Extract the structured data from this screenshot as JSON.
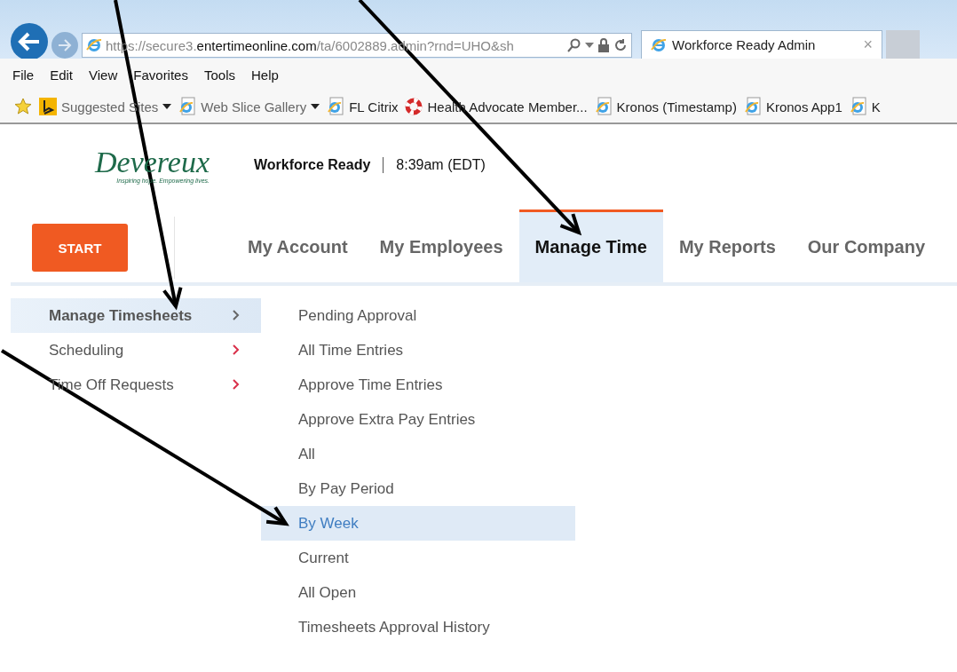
{
  "browser": {
    "url": {
      "prefix": "https://secure3.",
      "domain": "entertimeonline.com",
      "path": "/ta/6002889.admin?rnd=UHO&sh"
    },
    "tab": {
      "title": "Workforce Ready Admin",
      "close": "×"
    },
    "menu": [
      "File",
      "Edit",
      "View",
      "Favorites",
      "Tools",
      "Help"
    ],
    "favorites": [
      {
        "kind": "bing",
        "label": "Suggested Sites",
        "dropdown": true
      },
      {
        "kind": "ie",
        "label": "Web Slice Gallery",
        "dropdown": true
      },
      {
        "kind": "ie",
        "label": "FL Citrix",
        "dropdown": false
      },
      {
        "kind": "lifebuoy",
        "label": "Health Advocate Member...",
        "dropdown": false
      },
      {
        "kind": "ie",
        "label": "Kronos (Timestamp)",
        "dropdown": false
      },
      {
        "kind": "ie",
        "label": "Kronos App1",
        "dropdown": false
      },
      {
        "kind": "ie",
        "label": "K",
        "dropdown": false
      }
    ]
  },
  "header": {
    "logo": {
      "name": "Devereux",
      "tagline": "Inspiring hope. Empowering lives."
    },
    "product": "Workforce Ready",
    "time": "8:39am (EDT)"
  },
  "start_button": "START",
  "nav_tabs": [
    {
      "label": "My Account",
      "selected": false
    },
    {
      "label": "My Employees",
      "selected": false
    },
    {
      "label": "Manage Time",
      "selected": true
    },
    {
      "label": "My Reports",
      "selected": false
    },
    {
      "label": "Our Company",
      "selected": false
    }
  ],
  "side_menu": [
    {
      "label": "Manage Timesheets",
      "selected": true
    },
    {
      "label": "Scheduling",
      "selected": false
    },
    {
      "label": "Time Off Requests",
      "selected": false
    }
  ],
  "submenu": [
    {
      "label": "Pending Approval",
      "selected": false
    },
    {
      "label": "All Time Entries",
      "selected": false
    },
    {
      "label": "Approve Time Entries",
      "selected": false
    },
    {
      "label": "Approve Extra Pay Entries",
      "selected": false
    },
    {
      "label": "All",
      "selected": false
    },
    {
      "label": "By Pay Period",
      "selected": false
    },
    {
      "label": "By Week",
      "selected": true
    },
    {
      "label": "Current",
      "selected": false
    },
    {
      "label": "All Open",
      "selected": false
    },
    {
      "label": "Timesheets Approval History",
      "selected": false
    }
  ]
}
